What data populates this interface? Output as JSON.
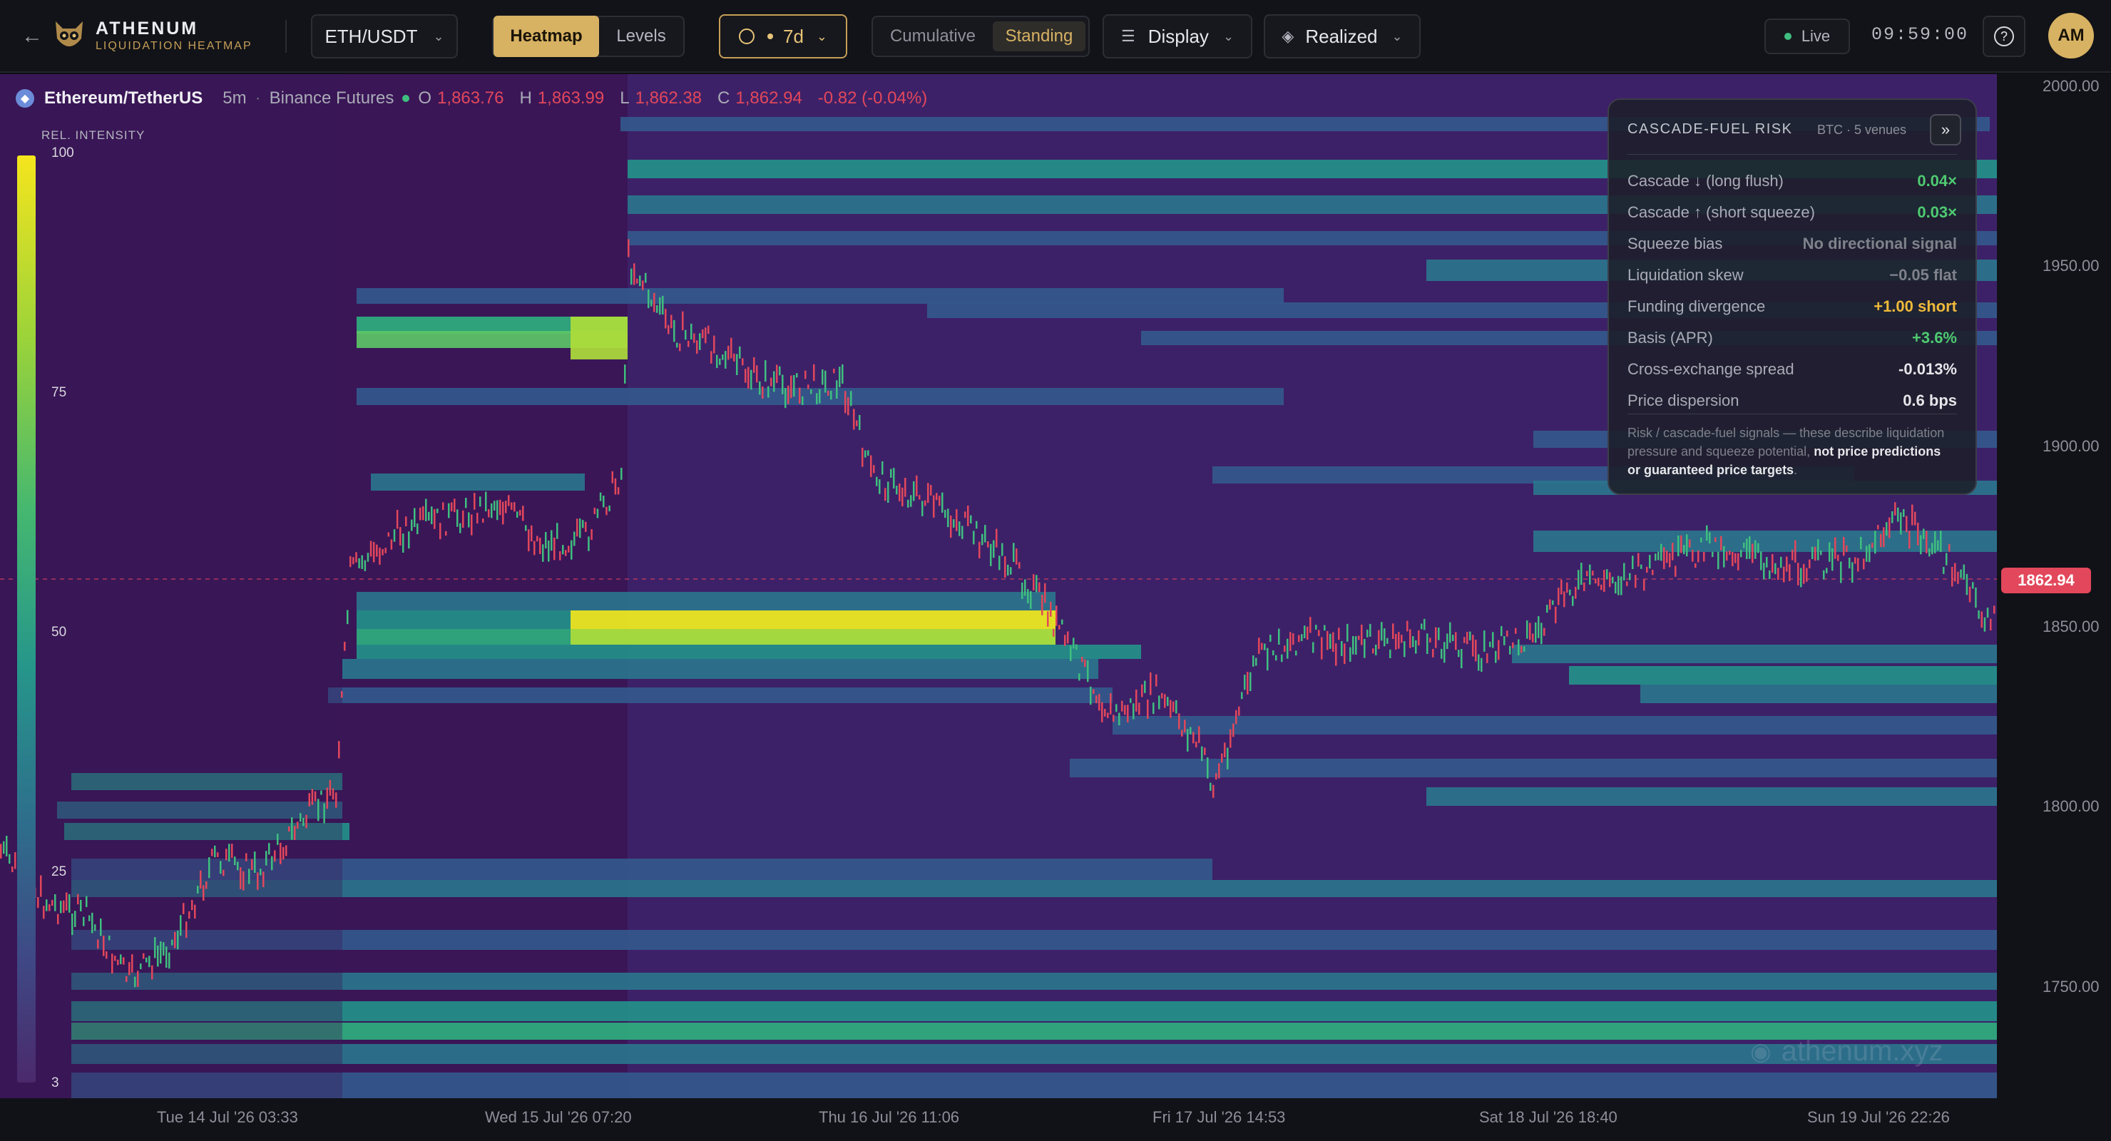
{
  "app": {
    "brand": "ATHENUM",
    "subtitle": "LIQUIDATION HEATMAP",
    "avatar": "AM",
    "clock": "09:59:00",
    "live": "Live"
  },
  "toolbar": {
    "pair": "ETH/USDT",
    "tabs": [
      "Heatmap",
      "Levels"
    ],
    "active_tab": "Heatmap",
    "range": "7d",
    "modes": [
      "Cumulative",
      "Standing"
    ],
    "active_mode": "Standing",
    "display": "Display",
    "realized": "Realized"
  },
  "info": {
    "name": "Ethereum/TetherUS",
    "interval": "5m",
    "exchange": "Binance Futures",
    "o_label": "O",
    "o": "1,863.76",
    "h_label": "H",
    "h": "1,863.99",
    "l_label": "L",
    "l": "1,862.38",
    "c_label": "C",
    "c": "1,862.94",
    "change": "-0.82 (-0.04%)"
  },
  "legend": {
    "title": "REL. INTENSITY",
    "ticks": [
      "100",
      "75",
      "50",
      "25",
      "3"
    ]
  },
  "risk": {
    "title": "CASCADE-FUEL RISK",
    "meta": "BTC · 5 venues",
    "rows": [
      {
        "k": "Cascade ↓ (long flush)",
        "v": "0.04×",
        "color": "#4ecb71"
      },
      {
        "k": "Cascade ↑ (short squeeze)",
        "v": "0.03×",
        "color": "#4ecb71"
      },
      {
        "k": "Squeeze bias",
        "v": "No directional signal",
        "color": "#7f818b"
      },
      {
        "k": "Liquidation skew",
        "v": "−0.05 flat",
        "color": "#7f818b"
      },
      {
        "k": "Funding divergence",
        "v": "+1.00 short",
        "color": "#f0b93a"
      },
      {
        "k": "Basis (APR)",
        "v": "+3.6%",
        "color": "#4ecb71"
      },
      {
        "k": "Cross-exchange spread",
        "v": "-0.013%",
        "color": "#e6e6ea"
      },
      {
        "k": "Price dispersion",
        "v": "0.6 bps",
        "color": "#e6e6ea"
      }
    ],
    "note_a": "Risk / cascade-fuel signals — these describe liquidation pressure and squeeze potential,",
    "note_b": "not price predictions or guaranteed price targets",
    "note_c": "."
  },
  "price_tag": "1862.94",
  "watermark": "athenum.xyz",
  "y_axis": [
    "2000.00",
    "1950.00",
    "1900.00",
    "1850.00",
    "1800.00",
    "1750.00"
  ],
  "x_axis": [
    "Tue 14 Jul '26 03:33",
    "Wed 15 Jul '26 07:20",
    "Thu 16 Jul '26 11:06",
    "Fri 17 Jul '26 14:53",
    "Sat 18 Jul '26 18:40",
    "Sun 19 Jul '26 22:26"
  ],
  "colors": {
    "up": "#3fbf7f",
    "down": "#e2475b",
    "accent": "#d8b263",
    "bg": "#3a1657"
  }
}
